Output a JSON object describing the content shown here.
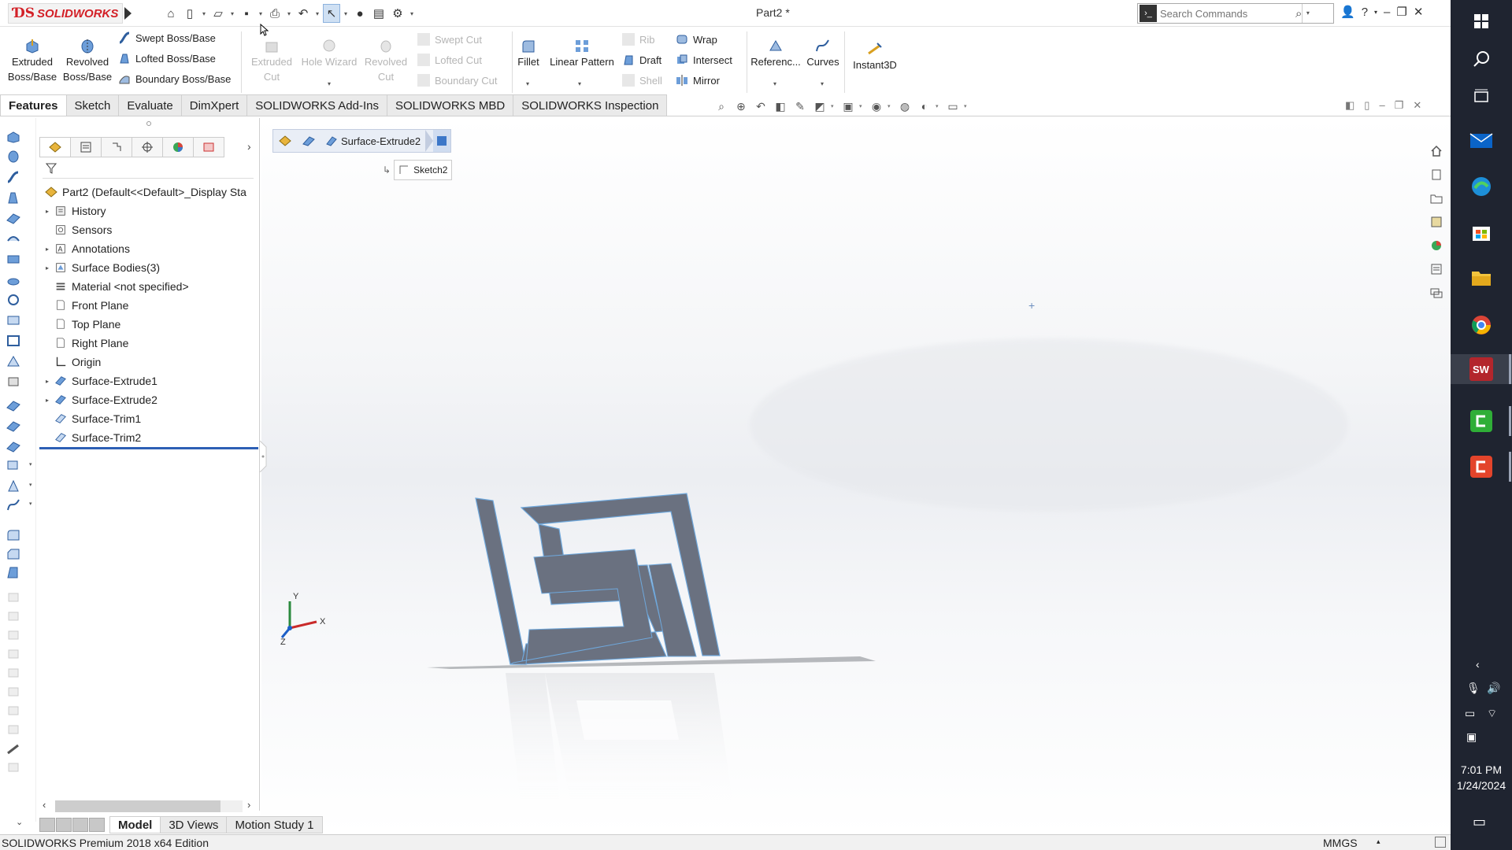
{
  "app": {
    "logo_ds": "ƊS",
    "logo_name": "SOLIDWORKS",
    "title": "Part2 *",
    "search_placeholder": "Search Commands"
  },
  "ribbon": {
    "extruded_boss": "Extruded Boss/Base",
    "revolved_boss": "Revolved Boss/Base",
    "swept_boss": "Swept Boss/Base",
    "lofted_boss": "Lofted Boss/Base",
    "boundary_boss": "Boundary Boss/Base",
    "extruded_cut": "Extruded Cut",
    "hole_wizard": "Hole Wizard",
    "revolved_cut": "Revolved Cut",
    "swept_cut": "Swept Cut",
    "lofted_cut": "Lofted Cut",
    "boundary_cut": "Boundary Cut",
    "fillet": "Fillet",
    "linear_pattern": "Linear Pattern",
    "rib": "Rib",
    "draft": "Draft",
    "shell": "Shell",
    "wrap": "Wrap",
    "intersect": "Intersect",
    "mirror": "Mirror",
    "reference": "Referenc...",
    "curves": "Curves",
    "instant3d": "Instant3D"
  },
  "tabs": [
    "Features",
    "Sketch",
    "Evaluate",
    "DimXpert",
    "SOLIDWORKS Add-Ins",
    "SOLIDWORKS MBD",
    "SOLIDWORKS Inspection"
  ],
  "feature_tree": {
    "root": "Part2  (Default<<Default>_Display Sta",
    "items": [
      {
        "label": "History",
        "expandable": true,
        "icon": "history-icon"
      },
      {
        "label": "Sensors",
        "expandable": false,
        "icon": "sensors-icon"
      },
      {
        "label": "Annotations",
        "expandable": true,
        "icon": "annotations-icon"
      },
      {
        "label": "Surface Bodies(3)",
        "expandable": true,
        "icon": "surface-bodies-icon"
      },
      {
        "label": "Material <not specified>",
        "expandable": false,
        "icon": "material-icon"
      },
      {
        "label": "Front Plane",
        "expandable": false,
        "icon": "plane-icon"
      },
      {
        "label": "Top Plane",
        "expandable": false,
        "icon": "plane-icon"
      },
      {
        "label": "Right Plane",
        "expandable": false,
        "icon": "plane-icon"
      },
      {
        "label": "Origin",
        "expandable": false,
        "icon": "origin-icon"
      },
      {
        "label": "Surface-Extrude1",
        "expandable": true,
        "icon": "surface-extrude-icon"
      },
      {
        "label": "Surface-Extrude2",
        "expandable": true,
        "icon": "surface-extrude-icon"
      },
      {
        "label": "Surface-Trim1",
        "expandable": false,
        "icon": "surface-trim-icon"
      },
      {
        "label": "Surface-Trim2",
        "expandable": false,
        "icon": "surface-trim-icon"
      }
    ]
  },
  "breadcrumb": {
    "feature": "Surface-Extrude2",
    "sketch": "Sketch2"
  },
  "model_tabs": [
    "Model",
    "3D Views",
    "Motion Study 1"
  ],
  "status": {
    "edition": "SOLIDWORKS Premium 2018 x64 Edition",
    "units": "MMGS"
  },
  "triad": {
    "x": "X",
    "y": "Y",
    "z": "Z"
  },
  "taskbar": {
    "time": "7:01 PM",
    "date": "1/24/2024"
  },
  "colors": {
    "brand_red": "#d32027",
    "model_surface": "#6a7180",
    "edge_blue": "#6fa8dc",
    "taskbar_bg": "#1f2430"
  }
}
